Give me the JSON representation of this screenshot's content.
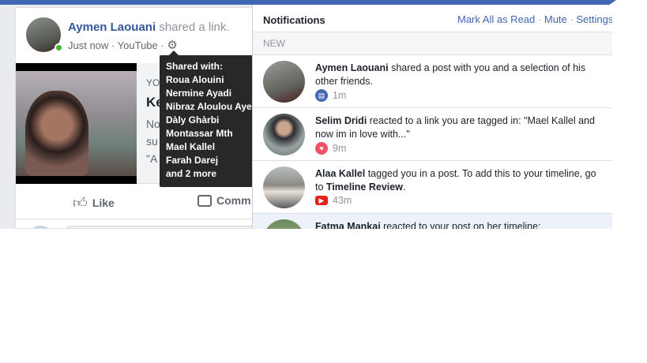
{
  "post": {
    "author": "Aymen Laouani",
    "action": "shared a link.",
    "time": "Just now",
    "source": "YouTube",
    "sep": "·",
    "link": {
      "source": "YO",
      "title": "Ke",
      "desc_lines": [
        "No",
        "su",
        "\"A"
      ]
    },
    "actions": {
      "like": "Like",
      "comment": "Comm"
    }
  },
  "tooltip": {
    "title": "Shared with:",
    "names": [
      "Roua Alouini",
      "Nermine Ayadi",
      "Nibraz Aloulou Aye",
      "Dàly Ghàrbi",
      "Montassar Mth",
      "Mael Kallel",
      "Farah Darej"
    ],
    "more": "and 2 more"
  },
  "notifications": {
    "title": "Notifications",
    "mark_all": "Mark All as Read",
    "mute": "Mute",
    "settings": "Settings",
    "sep": "·",
    "section": "NEW",
    "items": [
      {
        "name": "Aymen Laouani",
        "text": " shared a post with you and a selection of his other friends.",
        "time": "1m",
        "icon": "post-icon",
        "icon_color": "#4267b2"
      },
      {
        "name": "Selim Dridi",
        "text": " reacted to a link you are tagged in: \"Mael Kallel and now im in love with...\"",
        "time": "9m",
        "icon": "heart-icon",
        "icon_color": "#f25268"
      },
      {
        "name": "Alaa Kallel",
        "text": " tagged you in a post. To add this to your timeline, go to ",
        "bold2": "Timeline Review",
        "tail": ".",
        "time": "43m",
        "icon": "youtube-icon",
        "icon_color": "#e62117"
      },
      {
        "name": "Fatma Mankai",
        "text": " reacted to your post on her timeline:",
        "time": "",
        "icon": "",
        "icon_color": ""
      }
    ]
  }
}
